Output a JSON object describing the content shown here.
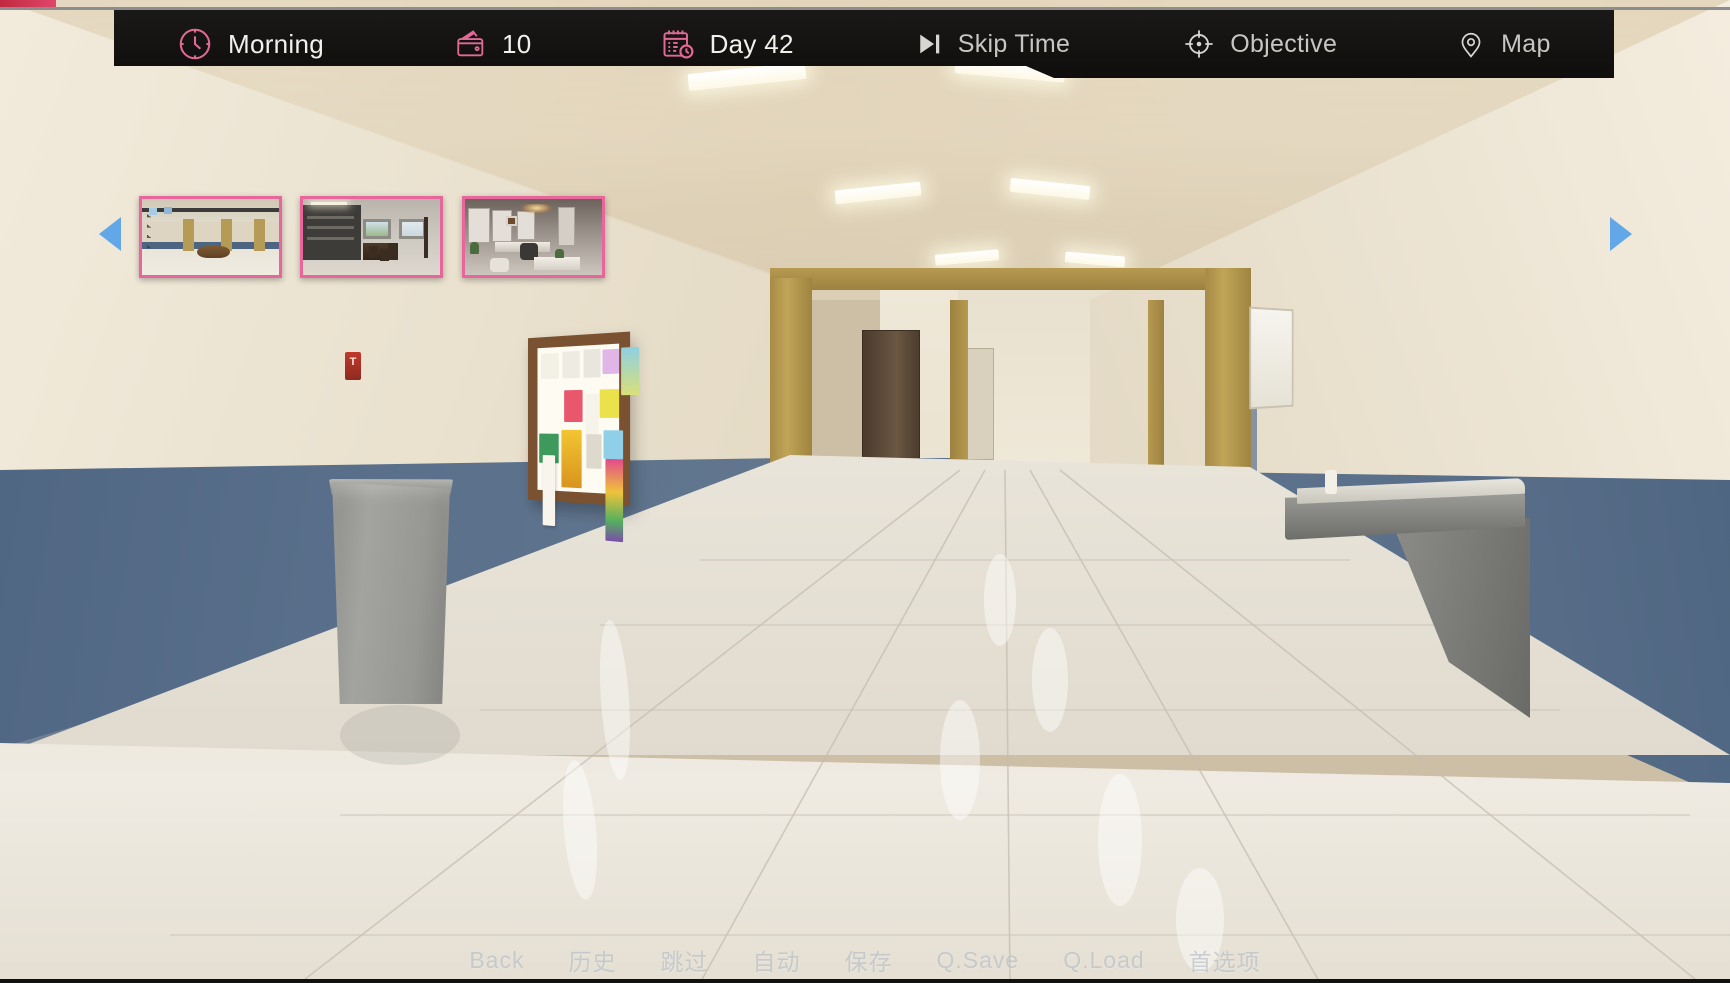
{
  "hud": {
    "segments": [
      {
        "key": "time",
        "icon": "clock-icon",
        "label": "Morning",
        "accent": "#e06a96"
      },
      {
        "key": "money",
        "icon": "wallet-icon",
        "label": "10",
        "accent": "#e06a96"
      },
      {
        "key": "day",
        "icon": "calendar-clock-icon",
        "label": "Day 42",
        "accent": "#e06a96"
      },
      {
        "key": "skip_time",
        "icon": "skip-forward-icon",
        "label": "Skip Time",
        "accent": "#c8c6c2"
      },
      {
        "key": "objective",
        "icon": "crosshair-icon",
        "label": "Objective",
        "accent": "#c8c6c2"
      },
      {
        "key": "map",
        "icon": "map-pin-icon",
        "label": "Map",
        "accent": "#c8c6c2"
      }
    ],
    "bar_color": "#151312",
    "accent_pink": "#e06a96"
  },
  "location_strip": {
    "prev_arrow": "◀",
    "next_arrow": "▶",
    "arrow_color": "#62a8e8",
    "border_color": "#e8669c",
    "thumbnails": [
      {
        "name": "school-lobby-thumbnail",
        "art": "lobby"
      },
      {
        "name": "office-room-thumbnail",
        "art": "office"
      },
      {
        "name": "library-study-thumbnail",
        "art": "library"
      }
    ]
  },
  "scene": {
    "name": "school-hallway",
    "objects": [
      "ceiling-light-panels",
      "bulletin-board",
      "fire-alarm-pull-station",
      "trash-can",
      "drinking-fountain",
      "corridor-doors",
      "blue-wainscot-walls",
      "tiled-reflective-floor"
    ]
  },
  "bottom_menu": {
    "items": [
      {
        "name": "back",
        "label": "Back"
      },
      {
        "name": "history",
        "label": "历史"
      },
      {
        "name": "skip",
        "label": "跳过"
      },
      {
        "name": "auto",
        "label": "自动"
      },
      {
        "name": "save",
        "label": "保存"
      },
      {
        "name": "quick-save",
        "label": "Q.Save"
      },
      {
        "name": "quick-load",
        "label": "Q.Load"
      },
      {
        "name": "preferences",
        "label": "首选项"
      }
    ]
  }
}
